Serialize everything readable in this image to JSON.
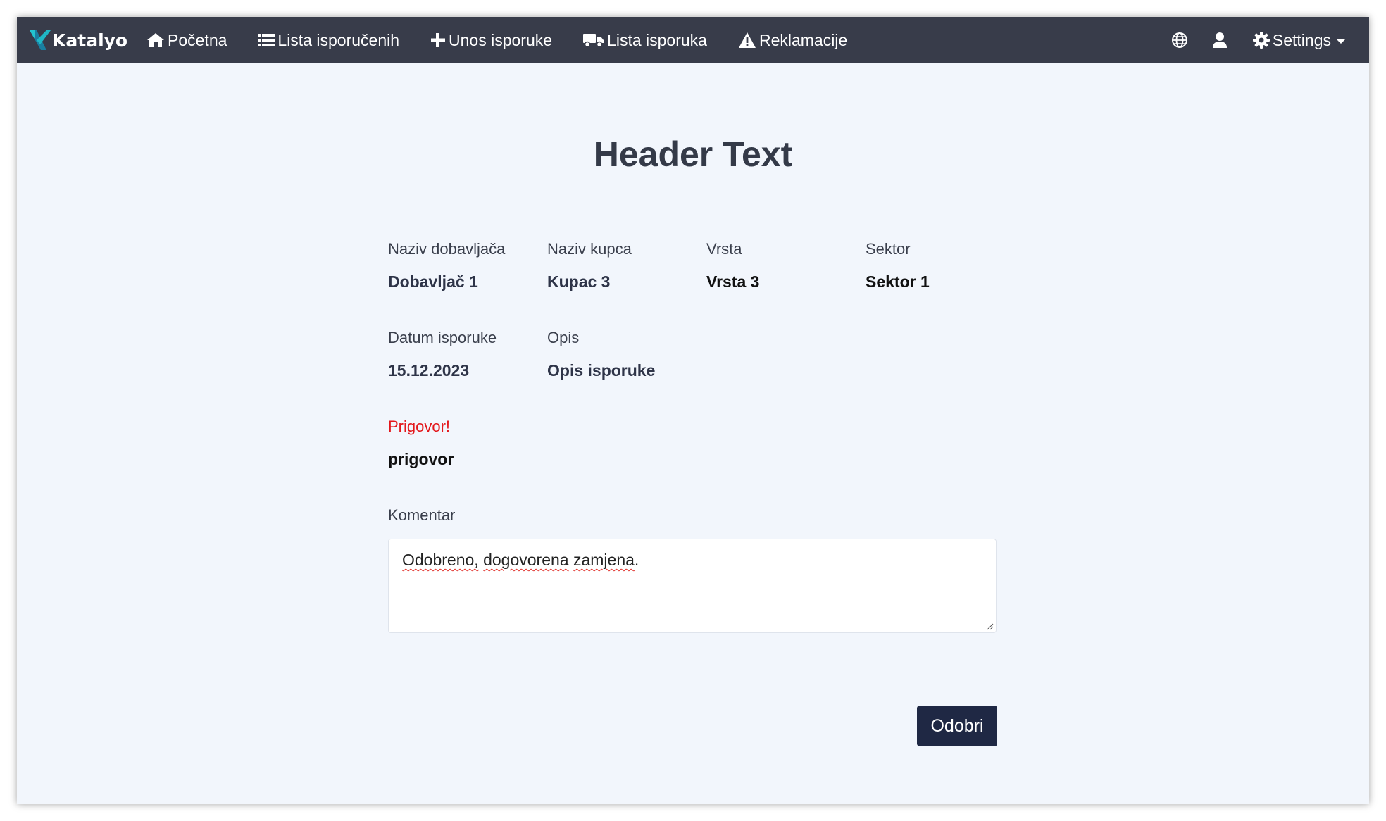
{
  "app": {
    "brand": "Katalyo"
  },
  "nav": {
    "items": [
      {
        "label": "Početna",
        "icon": "home-icon"
      },
      {
        "label": "Lista isporučenih",
        "icon": "list-icon"
      },
      {
        "label": "Unos isporuke",
        "icon": "plus-icon"
      },
      {
        "label": "Lista isporuka",
        "icon": "truck-icon"
      },
      {
        "label": "Reklamacije",
        "icon": "warning-icon"
      }
    ],
    "right": {
      "settings_label": "Settings"
    }
  },
  "page": {
    "title": "Header Text"
  },
  "fields": {
    "supplier": {
      "label": "Naziv dobavljača",
      "value": "Dobavljač 1"
    },
    "customer": {
      "label": "Naziv kupca",
      "value": "Kupac 3"
    },
    "type": {
      "label": "Vrsta",
      "value": "Vrsta 3"
    },
    "sector": {
      "label": "Sektor",
      "value": "Sektor 1"
    },
    "delivery_date": {
      "label": "Datum isporuke",
      "value": "15.12.2023"
    },
    "description": {
      "label": "Opis",
      "value": "Opis isporuke"
    },
    "objection": {
      "label": "Prigovor!",
      "value": "prigovor"
    }
  },
  "comment": {
    "label": "Komentar",
    "words": [
      "Odobreno,",
      "dogovorena",
      "zamjena."
    ]
  },
  "actions": {
    "approve_label": "Odobri"
  },
  "colors": {
    "navbar": "#383c4a",
    "page_bg": "#f2f6fc",
    "accent_brand": "#1fb8c6",
    "objection_label": "#e3171b",
    "approve_button": "#1f2844"
  }
}
